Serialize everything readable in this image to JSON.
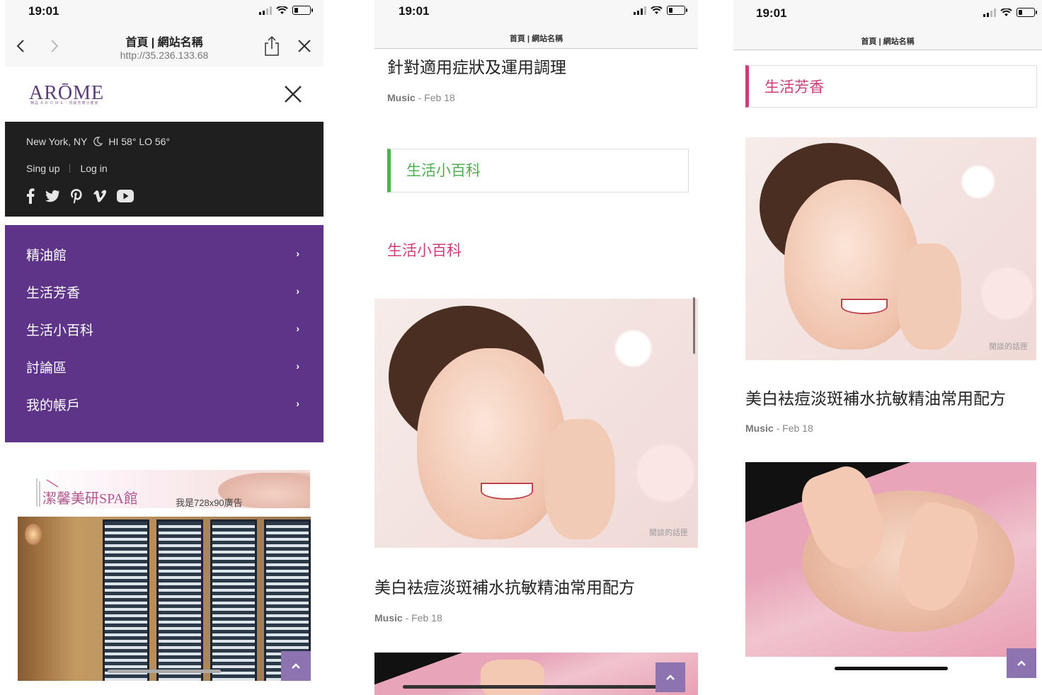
{
  "status": {
    "time": "19:01"
  },
  "screen1": {
    "browser": {
      "title": "首頁 | 網站名稱",
      "url": "http://35.236.133.68"
    },
    "logo": {
      "text": "ARŌME",
      "subtitle": "精品 A R O M E ‧ 頂級芳療沙龍會"
    },
    "weather": {
      "location": "New York, NY",
      "temps": "HI 58° LO 56°"
    },
    "auth": {
      "signup": "Sing up",
      "login": "Log in"
    },
    "social_icons": [
      "facebook-icon",
      "twitter-icon",
      "pinterest-icon",
      "vimeo-icon",
      "youtube-icon"
    ],
    "menu": [
      {
        "label": "精油館"
      },
      {
        "label": "生活芳香"
      },
      {
        "label": "生活小百科"
      },
      {
        "label": "討論區"
      },
      {
        "label": "我的帳戶"
      }
    ],
    "ad": {
      "brand": "潔馨美研SPA館",
      "note": "我是728x90廣告"
    }
  },
  "screen2": {
    "bar_title": "首頁 | 網站名稱",
    "top_post": {
      "title": "針對適用症狀及運用調理",
      "category": "Music",
      "date": "Feb 18"
    },
    "section_box": "生活小百科",
    "section_heading": "生活小百科",
    "post": {
      "title": "美白袪痘淡斑補水抗敏精油常用配方",
      "category": "Music",
      "date": "Feb 18",
      "watermark": "閒談的話匣"
    }
  },
  "screen3": {
    "bar_title": "首頁 | 網站名稱",
    "section_box": "生活芳香",
    "post": {
      "title": "美白袪痘淡斑補水抗敏精油常用配方",
      "category": "Music",
      "date": "Feb 18",
      "watermark": "閒談的話匣"
    }
  },
  "colors": {
    "menu_bg": "#5e3489",
    "scroll_top": "#8d73b0",
    "green_accent": "#4caf50",
    "pink_accent": "#cc3d7a",
    "dark_panel": "#1f1f1f"
  },
  "meta_separator": "-"
}
